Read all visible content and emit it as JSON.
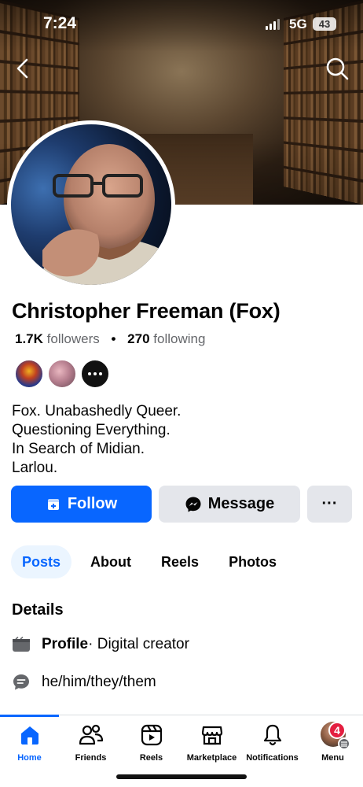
{
  "status_bar": {
    "time": "7:24",
    "network": "5G",
    "battery": "43"
  },
  "profile": {
    "name": "Christopher Freeman (Fox)",
    "followers_count": "1.7K",
    "followers_label": "followers",
    "following_count": "270",
    "following_label": "following",
    "bio_lines": [
      "Fox. Unabashedly Queer.",
      "Questioning Everything.",
      "In Search of Midian.",
      "Larlou."
    ]
  },
  "actions": {
    "follow_label": "Follow",
    "message_label": "Message",
    "more_label": "···"
  },
  "tabs": [
    {
      "label": "Posts",
      "active": true
    },
    {
      "label": "About",
      "active": false
    },
    {
      "label": "Reels",
      "active": false
    },
    {
      "label": "Photos",
      "active": false
    }
  ],
  "details": {
    "heading": "Details",
    "profile_label": "Profile",
    "profile_value": " · Digital creator",
    "pronouns": "he/him/they/them"
  },
  "bottom_nav": [
    {
      "label": "Home",
      "icon": "home-icon",
      "active": true
    },
    {
      "label": "Friends",
      "icon": "friends-icon",
      "active": false
    },
    {
      "label": "Reels",
      "icon": "reels-icon",
      "active": false
    },
    {
      "label": "Marketplace",
      "icon": "marketplace-icon",
      "active": false
    },
    {
      "label": "Notifications",
      "icon": "bell-icon",
      "active": false
    },
    {
      "label": "Menu",
      "icon": "avatar-menu-icon",
      "active": false
    }
  ],
  "menu_badge": "4",
  "colors": {
    "accent": "#0866ff",
    "badge": "#e41e3f",
    "secondary_button": "#e4e6eb",
    "active_tab_bg": "#ebf5ff"
  }
}
